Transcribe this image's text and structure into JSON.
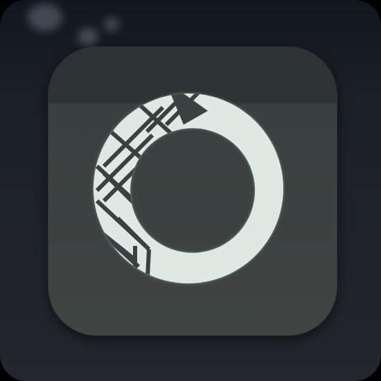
{
  "icon": {
    "name": "anaconda-navigator-app-icon",
    "logo_icon": "anaconda-ring-icon",
    "colors": {
      "background": "#1b1f27",
      "tile": "#3a403f",
      "logo": "#dfe9e3"
    }
  }
}
